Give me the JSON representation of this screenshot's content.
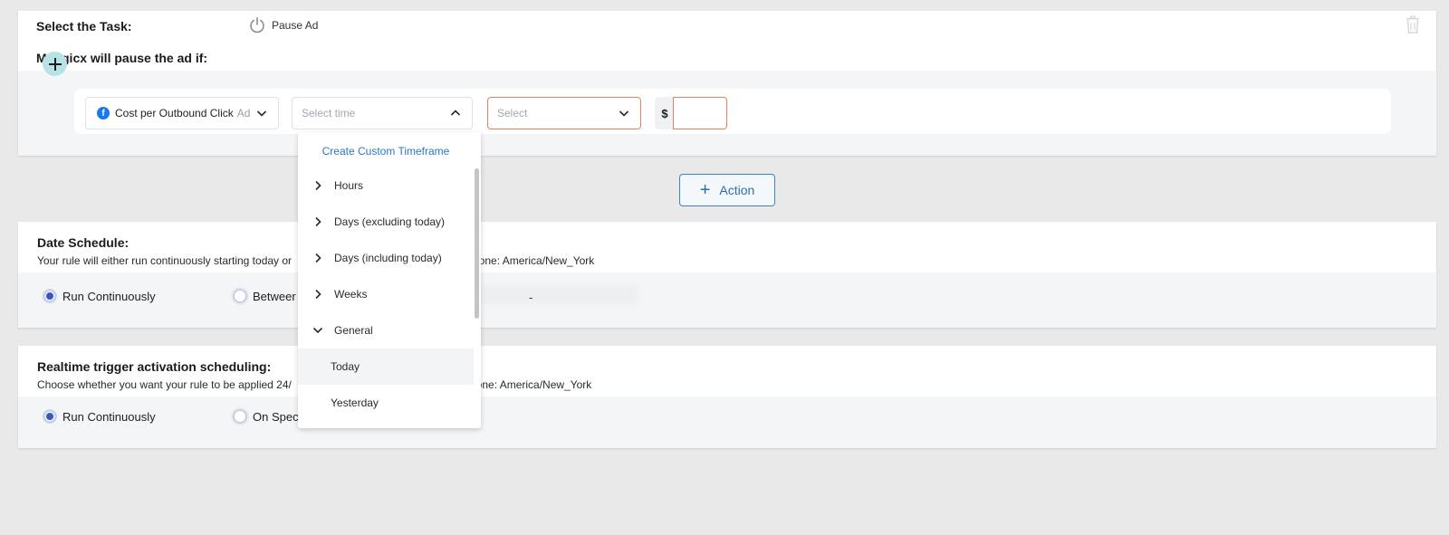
{
  "task": {
    "label": "Select the Task:",
    "pause_label": "Pause Ad",
    "condition_heading": "Madgicx will pause the ad if:"
  },
  "condition": {
    "metric_text": "Cost per Outbound Click",
    "metric_level": "Ad",
    "time_placeholder": "Select time",
    "operator_placeholder": "Select",
    "currency": "$",
    "value": ""
  },
  "time_menu": {
    "custom_label": "Create Custom Timeframe",
    "groups": [
      {
        "label": "Hours",
        "expanded": false
      },
      {
        "label": "Days (excluding today)",
        "expanded": false
      },
      {
        "label": "Days (including today)",
        "expanded": false
      },
      {
        "label": "Weeks",
        "expanded": false
      },
      {
        "label": "General",
        "expanded": true
      }
    ],
    "general_items": [
      "Today",
      "Yesterday"
    ],
    "highlighted": "Today"
  },
  "action_button": {
    "label": "Action"
  },
  "date_schedule": {
    "title": "Date Schedule:",
    "desc": "Your rule will either run continuously starting today or",
    "timezone": "ezone: America/New_York",
    "option_continuous": "Run Continuously",
    "option_between": "Betweer",
    "dash": "-"
  },
  "realtime": {
    "title": "Realtime trigger activation scheduling:",
    "desc": "Choose whether you want your rule to be applied 24/",
    "timezone": "ezone: America/New_York",
    "option_continuous": "Run Continuously",
    "option_specific": "On Spec"
  },
  "colors": {
    "accent": "#2c77c6",
    "radio_selected": "#3b57b6",
    "error_border": "#e0835b",
    "facebook": "#1877f2"
  }
}
